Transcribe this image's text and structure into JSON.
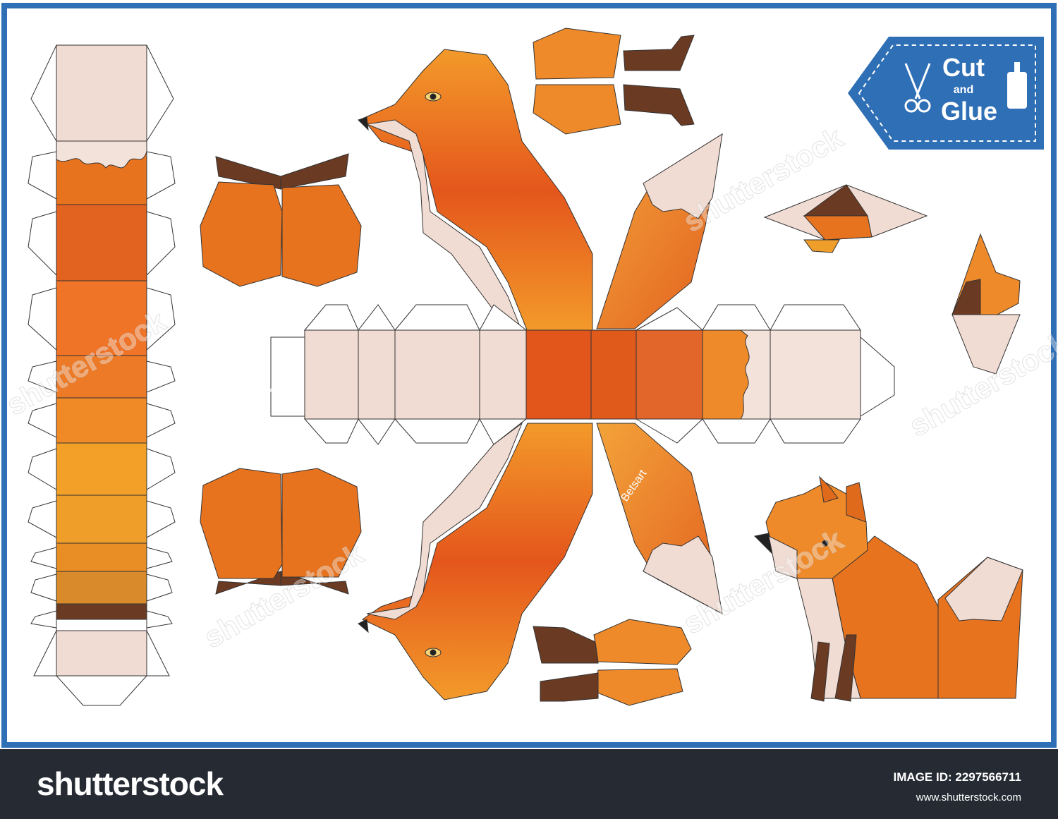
{
  "badge": {
    "line1": "Cut",
    "line2": "and",
    "line3": "Glue",
    "color": "#2f6fb5",
    "scissors_icon": "scissors-icon",
    "glue_icon": "glue-bottle-icon"
  },
  "signature_text": "Betsart",
  "watermark": "shutterstock",
  "footer": {
    "logo": "shutterstock",
    "image_id_label": "IMAGE ID: 2297566711",
    "url": "www.shutterstock.com"
  },
  "colors": {
    "frame": "#2f6fb5",
    "orange": "#e8731f",
    "light_orange": "#f2a23a",
    "deep_orange": "#d9541c",
    "cream": "#f1dcd3",
    "brown": "#6b3a22"
  }
}
